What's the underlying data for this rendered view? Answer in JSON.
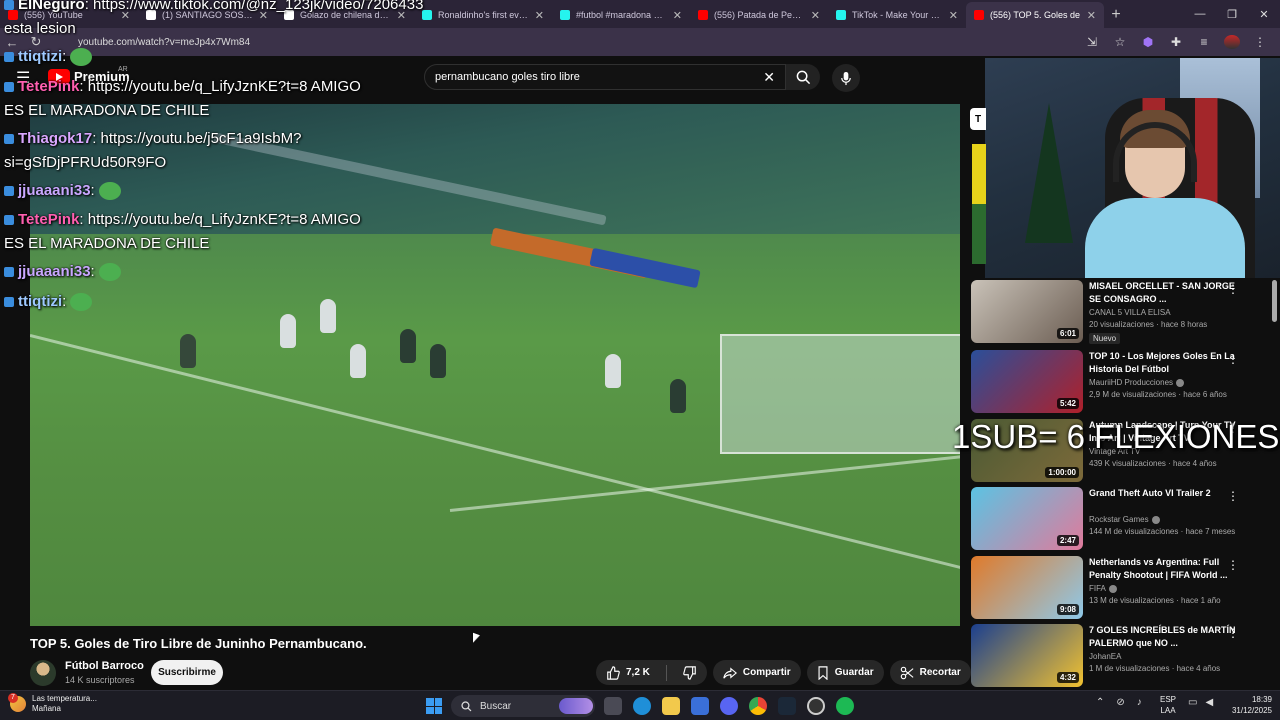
{
  "browser": {
    "tabs": [
      {
        "title": "(556) YouTube",
        "color": "#ff0000"
      },
      {
        "title": "(1) SANTIAGO SOSA - Se",
        "color": "#ffffff"
      },
      {
        "title": "Golazo de chilena de Mc",
        "color": "#ffffff"
      },
      {
        "title": "Ronaldinho's first ever go",
        "color": "#25f4ee"
      },
      {
        "title": "#futbol #maradona #fue",
        "color": "#25f4ee"
      },
      {
        "title": "(556) Patada de Pepe a C",
        "color": "#ff0000"
      },
      {
        "title": "TikTok - Make Your Day",
        "color": "#25f4ee"
      },
      {
        "title": "(556) TOP 5. Goles de",
        "color": "#ff0000"
      }
    ],
    "new_tab": "+",
    "url": "youtube.com/watch?v=meJp4x7Wm84"
  },
  "youtube": {
    "logo_text": "Premium",
    "country": "AR",
    "search_query": "pernambucano goles tiro libre",
    "video_title": "TOP 5. Goles de Tiro Libre de Juninho Pernambucano.",
    "channel_name": "Fútbol Barroco",
    "channel_subs": "14 K suscriptores",
    "subscribe_label": "Suscribirme",
    "likes": "7,2 K",
    "share_label": "Compartir",
    "save_label": "Guardar",
    "clip_label": "Recortar",
    "chip_letter": "T"
  },
  "chat": [
    {
      "name": "ElNeguro",
      "name_color": "#ffffff",
      "text": ": https://www.tiktok.com/@nz_123jk/video/7206433"
    },
    {
      "name": "",
      "name_color": "#ffffff",
      "text": "esta lesion"
    },
    {
      "name": "ttiqtizi",
      "name_color": "#9ec9ff",
      "text": ":"
    },
    {
      "name": "TetePink",
      "name_color": "#ff5fb0",
      "text": ": https://youtu.be/q_LifyJznKE?t=8 AMIGO"
    },
    {
      "name": "",
      "name_color": "#ffffff",
      "text": "ES EL MARADONA DE CHILE"
    },
    {
      "name": "Thiagok17",
      "name_color": "#d9a7ff",
      "text": ": https://youtu.be/j5cF1a9IsbM?"
    },
    {
      "name": "",
      "name_color": "#ffffff",
      "text": "si=gSfDjPFRUd50R9FO"
    },
    {
      "name": "jjuaaani33",
      "name_color": "#c9a7ff",
      "text": ":"
    },
    {
      "name": "TetePink",
      "name_color": "#ff5fb0",
      "text": ": https://youtu.be/q_LifyJznKE?t=8 AMIGO"
    },
    {
      "name": "",
      "name_color": "#ffffff",
      "text": "ES EL MARADONA DE CHILE"
    },
    {
      "name": "jjuaaani33",
      "name_color": "#c9a7ff",
      "text": ":"
    },
    {
      "name": "ttiqtizi",
      "name_color": "#9ec9ff",
      "text": ":"
    }
  ],
  "recommendations": [
    {
      "title": "MISAEL ORCELLET - SAN JORGE SE CONSAGRO ...",
      "channel": "CANAL 5 VILLA ELISA",
      "verified": false,
      "meta": "20 visualizaciones · hace 8 horas",
      "duration": "6:01",
      "badge": "Nuevo",
      "thumb_a": "#c9c2b8",
      "thumb_b": "#6b5d52"
    },
    {
      "title": "TOP 10 - Los Mejores Goles En La Historia Del Fútbol",
      "channel": "MauriiHD Producciones",
      "verified": true,
      "meta": "2,9 M de visualizaciones · hace 6 años",
      "duration": "5:42",
      "badge": "",
      "thumb_a": "#2a4f9a",
      "thumb_b": "#b0202a"
    },
    {
      "title": "Autumn Landscape | Turn Your TV Into Art | Vintage Art TV",
      "channel": "Vintage Art TV",
      "verified": false,
      "meta": "439 K visualizaciones · hace 4 años",
      "duration": "1:00:00",
      "badge": "",
      "thumb_a": "#4b5a34",
      "thumb_b": "#7d6a3a"
    },
    {
      "title": "Grand Theft Auto VI Trailer 2",
      "channel": "Rockstar Games",
      "verified": true,
      "meta": "144 M de visualizaciones · hace 7 meses",
      "duration": "2:47",
      "badge": "",
      "thumb_a": "#5bc3e3",
      "thumb_b": "#e07a9b"
    },
    {
      "title": "Netherlands vs Argentina: Full Penalty Shootout | FIFA World ...",
      "channel": "FIFA",
      "verified": true,
      "meta": "13 M de visualizaciones · hace 1 año",
      "duration": "9:08",
      "badge": "",
      "thumb_a": "#e07a2a",
      "thumb_b": "#8ec9ea"
    },
    {
      "title": "7 GOLES INCREÍBLES de MARTÍN PALERMO que NO ...",
      "channel": "JohanEA",
      "verified": false,
      "meta": "1 M de visualizaciones · hace 4 años",
      "duration": "4:32",
      "badge": "",
      "thumb_a": "#1b3f8f",
      "thumb_b": "#f2c230"
    }
  ],
  "overlay_text": "1SUB= 6 FLEXIONES",
  "taskbar": {
    "weather_badge": "7",
    "weather_line1": "Las temperatura...",
    "weather_line2": "Mañana",
    "search_placeholder": "Buscar",
    "lang_line1": "ESP",
    "lang_line2": "LAA",
    "time": "18:39",
    "date": "31/12/2025"
  },
  "colors": {
    "yt_red": "#ff0000",
    "accent_purple": "#3b3249"
  }
}
